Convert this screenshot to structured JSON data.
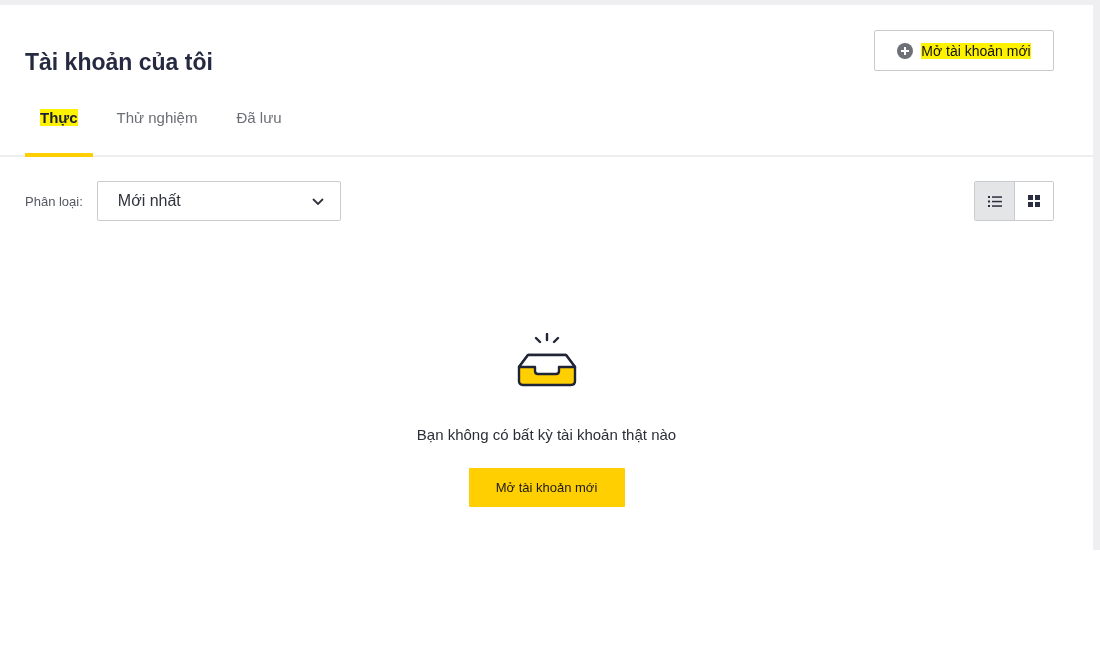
{
  "header": {
    "title": "Tài khoản của tôi",
    "action": {
      "label": "Mở tài khoản mới",
      "highlighted": true
    }
  },
  "tabs": [
    {
      "label": "Thực",
      "selected": true,
      "highlighted": true
    },
    {
      "label": "Thử nghiệm",
      "selected": false,
      "highlighted": false
    },
    {
      "label": "Đã lưu",
      "selected": false,
      "highlighted": false
    }
  ],
  "filter": {
    "label": "Phân loại:",
    "value": "Mới nhất"
  },
  "view_modes": [
    {
      "kind": "list",
      "selected": true
    },
    {
      "kind": "grid",
      "selected": false
    }
  ],
  "empty_state": {
    "message": "Bạn không có bất kỳ tài khoản thật nào",
    "button": "Mở tài khoản mới"
  }
}
